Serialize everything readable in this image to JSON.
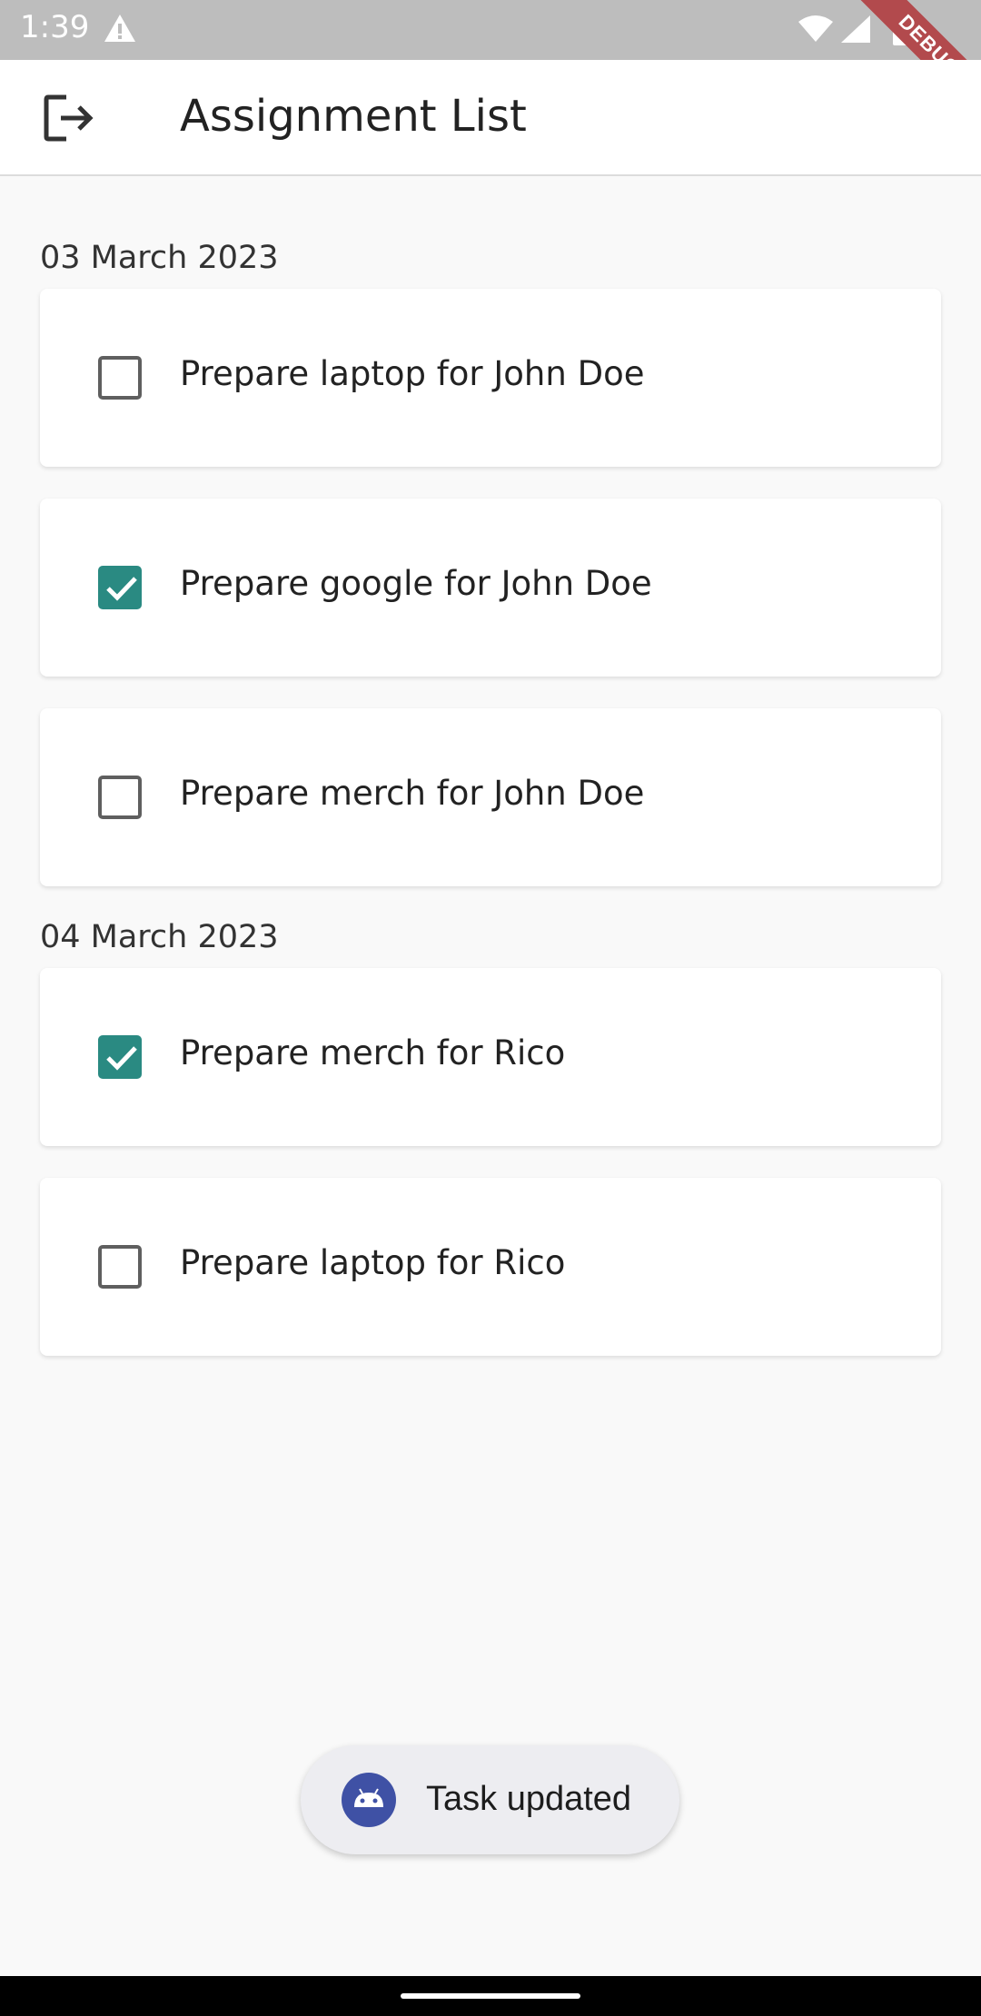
{
  "status_bar": {
    "time": "1:39",
    "debug_label": "DEBUG"
  },
  "app_bar": {
    "title": "Assignment List"
  },
  "groups": [
    {
      "date": "03 March 2023",
      "tasks": [
        {
          "label": "Prepare laptop for John Doe",
          "checked": false
        },
        {
          "label": "Prepare google for John Doe",
          "checked": true
        },
        {
          "label": "Prepare merch for John Doe",
          "checked": false
        }
      ]
    },
    {
      "date": "04 March 2023",
      "tasks": [
        {
          "label": "Prepare merch for Rico",
          "checked": true
        },
        {
          "label": "Prepare laptop for Rico",
          "checked": false
        }
      ]
    }
  ],
  "toast": {
    "message": "Task updated"
  },
  "colors": {
    "accent": "#2a8a82",
    "debug_ribbon": "#b24a4d"
  }
}
